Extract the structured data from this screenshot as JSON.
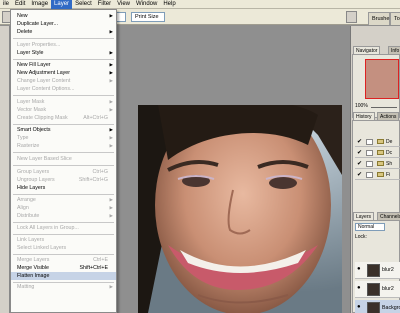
{
  "menubar": {
    "items": [
      "ile",
      "Edit",
      "Image",
      "Layer",
      "Select",
      "Filter",
      "View",
      "Window",
      "Help"
    ],
    "active_index": 3
  },
  "optbar": {
    "resize_windows_label": "",
    "print_size_label": "Print Size",
    "brushes_tab": "Brushe",
    "tool_tab": "Too"
  },
  "layer_menu": {
    "items": [
      {
        "label": "New",
        "shortcut": "",
        "submenu": true,
        "disabled": false
      },
      {
        "label": "Duplicate Layer...",
        "shortcut": "",
        "submenu": false,
        "disabled": false
      },
      {
        "label": "Delete",
        "shortcut": "",
        "submenu": true,
        "disabled": false
      },
      {
        "label": "Layer Properties...",
        "shortcut": "",
        "submenu": false,
        "disabled": true
      },
      {
        "label": "Layer Style",
        "shortcut": "",
        "submenu": true,
        "disabled": false
      },
      {
        "label": "New Fill Layer",
        "shortcut": "",
        "submenu": true,
        "disabled": false
      },
      {
        "label": "New Adjustment Layer",
        "shortcut": "",
        "submenu": true,
        "disabled": false
      },
      {
        "label": "Change Layer Content",
        "shortcut": "",
        "submenu": true,
        "disabled": true
      },
      {
        "label": "Layer Content Options...",
        "shortcut": "",
        "submenu": false,
        "disabled": true
      },
      {
        "label": "Layer Mask",
        "shortcut": "",
        "submenu": true,
        "disabled": true
      },
      {
        "label": "Vector Mask",
        "shortcut": "",
        "submenu": true,
        "disabled": true
      },
      {
        "label": "Create Clipping Mask",
        "shortcut": "Alt+Ctrl+G",
        "submenu": false,
        "disabled": true
      },
      {
        "label": "Smart Objects",
        "shortcut": "",
        "submenu": true,
        "disabled": false
      },
      {
        "label": "Type",
        "shortcut": "",
        "submenu": true,
        "disabled": true
      },
      {
        "label": "Rasterize",
        "shortcut": "",
        "submenu": true,
        "disabled": true
      },
      {
        "label": "New Layer Based Slice",
        "shortcut": "",
        "submenu": false,
        "disabled": true
      },
      {
        "label": "Group Layers",
        "shortcut": "Ctrl+G",
        "submenu": false,
        "disabled": true
      },
      {
        "label": "Ungroup Layers",
        "shortcut": "Shift+Ctrl+G",
        "submenu": false,
        "disabled": true
      },
      {
        "label": "Hide Layers",
        "shortcut": "",
        "submenu": false,
        "disabled": false
      },
      {
        "label": "Arrange",
        "shortcut": "",
        "submenu": true,
        "disabled": true
      },
      {
        "label": "Align",
        "shortcut": "",
        "submenu": true,
        "disabled": true
      },
      {
        "label": "Distribute",
        "shortcut": "",
        "submenu": true,
        "disabled": true
      },
      {
        "label": "Lock All Layers in Group...",
        "shortcut": "",
        "submenu": false,
        "disabled": true
      },
      {
        "label": "Link Layers",
        "shortcut": "",
        "submenu": false,
        "disabled": true
      },
      {
        "label": "Select Linked Layers",
        "shortcut": "",
        "submenu": false,
        "disabled": true
      },
      {
        "label": "Merge Layers",
        "shortcut": "Ctrl+E",
        "submenu": false,
        "disabled": true
      },
      {
        "label": "Merge Visible",
        "shortcut": "Shift+Ctrl+E",
        "submenu": false,
        "disabled": false
      },
      {
        "label": "Flatten Image",
        "shortcut": "",
        "submenu": false,
        "disabled": false,
        "highlight": true
      },
      {
        "label": "Matting",
        "shortcut": "",
        "submenu": true,
        "disabled": true
      }
    ]
  },
  "navigator": {
    "tab_label": "Navigator",
    "tab2_label": "Info",
    "zoom": "100%"
  },
  "history": {
    "tab_label": "History",
    "tab2_label": "Actions",
    "rows": [
      "De",
      "Dc",
      "Sh",
      "Fi"
    ]
  },
  "layers": {
    "tab_label": "Layers",
    "tab2_label": "Channels",
    "blend_mode": "Normal",
    "lock_label": "Lock:",
    "rows": [
      {
        "name": "blur2",
        "selected": false
      },
      {
        "name": "blur2",
        "selected": false
      },
      {
        "name": "Backgrou",
        "selected": true
      }
    ]
  },
  "colors": {
    "menu_highlight": "#c6d3e6",
    "active_menu": "#316ac5",
    "workspace": "#8f8f8f"
  }
}
